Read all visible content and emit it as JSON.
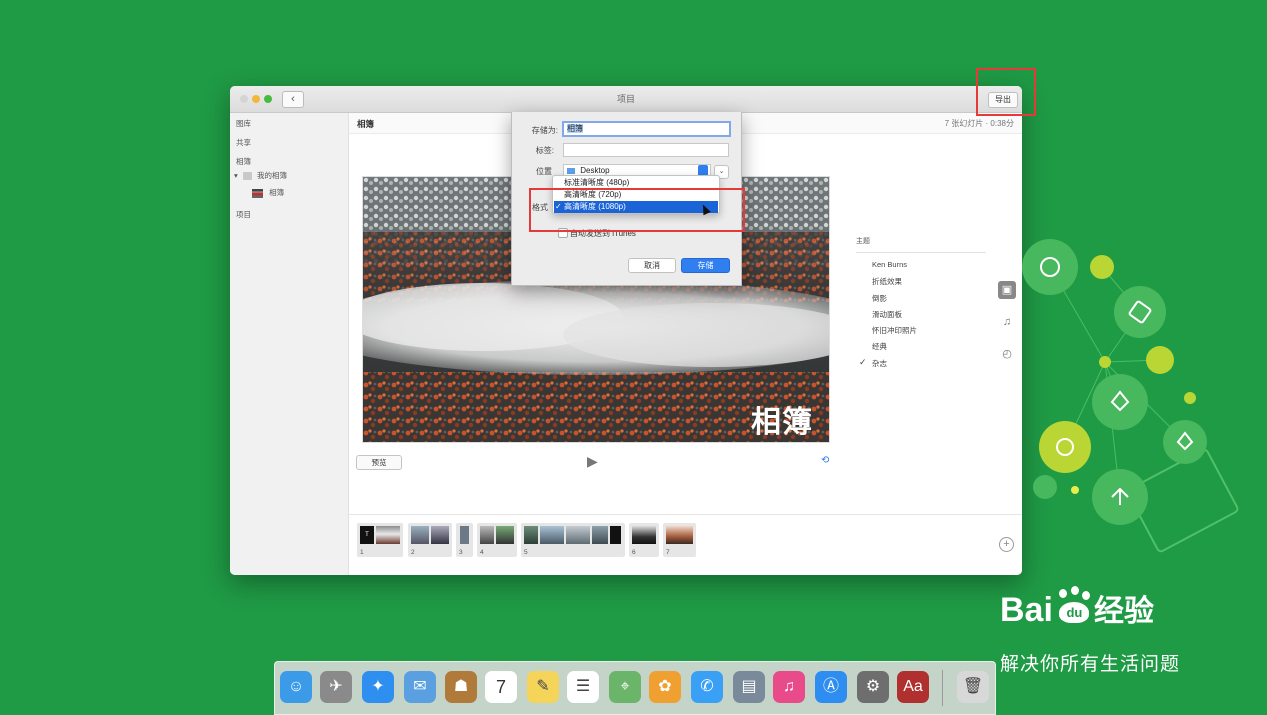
{
  "window": {
    "title": "项目",
    "export_label": "导出",
    "back_glyph": "‹"
  },
  "sidebar": {
    "items": [
      {
        "label": "图库"
      },
      {
        "label": "共享"
      },
      {
        "label": "相簿"
      },
      {
        "label": "我的相簿"
      },
      {
        "label": "相簿"
      },
      {
        "label": "项目"
      }
    ]
  },
  "header": {
    "title": "相簿",
    "info": "7 张幻灯片 · 0:38分"
  },
  "preview": {
    "overlay_text": "相簿",
    "preview_label": "预览"
  },
  "themes": {
    "title": "主题",
    "items": [
      {
        "label": "Ken Burns"
      },
      {
        "label": "折纸效果"
      },
      {
        "label": "倒影"
      },
      {
        "label": "滑动面板"
      },
      {
        "label": "怀旧冲印照片"
      },
      {
        "label": "经典"
      },
      {
        "label": "杂志",
        "checked": true
      }
    ],
    "check_glyph": "✓"
  },
  "tools": {
    "music_glyph": "♫",
    "timer_glyph": "◴",
    "layout_glyph": "▣"
  },
  "filmstrip": {
    "clips": [
      {
        "num": "1"
      },
      {
        "num": "2"
      },
      {
        "num": "3"
      },
      {
        "num": "4"
      },
      {
        "num": "5"
      },
      {
        "num": "6"
      },
      {
        "num": "7"
      }
    ],
    "first_thumb_text": "T",
    "add_glyph": "+"
  },
  "dialog": {
    "save_as_label": "存储为:",
    "save_as_value": "相簿",
    "tags_label": "标签:",
    "tags_value": "",
    "location_label": "位置",
    "location_value": "Desktop",
    "format_label": "格式",
    "format_options": [
      {
        "label": "标准清晰度 (480p)"
      },
      {
        "label": "高清晰度 (720p)"
      },
      {
        "label": "高清晰度 (1080p)",
        "selected": true
      }
    ],
    "itunes_label": "自动发送到 iTunes",
    "cancel_label": "取消",
    "save_label": "存储"
  },
  "dock": {
    "icons": [
      {
        "name": "finder-icon",
        "glyph": "☺",
        "color": "#3b9be8"
      },
      {
        "name": "launchpad-icon",
        "glyph": "✈",
        "color": "#8a8a8a"
      },
      {
        "name": "safari-icon",
        "glyph": "✦",
        "color": "#2f8ff0"
      },
      {
        "name": "mail-icon",
        "glyph": "✉",
        "color": "#5aa0e0"
      },
      {
        "name": "contacts-icon",
        "glyph": "☗",
        "color": "#b07a3a"
      },
      {
        "name": "calendar-icon",
        "glyph": "7",
        "color": "#ffffff"
      },
      {
        "name": "notes-icon",
        "glyph": "✎",
        "color": "#f5d45a"
      },
      {
        "name": "reminders-icon",
        "glyph": "☰",
        "color": "#ffffff"
      },
      {
        "name": "maps-icon",
        "glyph": "⌖",
        "color": "#6ab56a"
      },
      {
        "name": "photos-icon",
        "glyph": "✿",
        "color": "#f0a030"
      },
      {
        "name": "messages-icon",
        "glyph": "✆",
        "color": "#3aa0f5"
      },
      {
        "name": "image-capture-icon",
        "glyph": "▤",
        "color": "#7a8a9a"
      },
      {
        "name": "itunes-icon",
        "glyph": "♫",
        "color": "#e84a8a"
      },
      {
        "name": "app-store-icon",
        "glyph": "Ⓐ",
        "color": "#2e8df0"
      },
      {
        "name": "system-preferences-icon",
        "glyph": "⚙",
        "color": "#6e6e6e"
      },
      {
        "name": "dictionary-icon",
        "glyph": "Aa",
        "color": "#b03030"
      },
      {
        "name": "trash-icon",
        "glyph": "🗑",
        "color": "#d8d8d8"
      }
    ]
  },
  "watermark": {
    "logo_text": "Bai",
    "logo_du": "du",
    "logo_suffix": "经验",
    "tagline": "解决你所有生活问题"
  }
}
